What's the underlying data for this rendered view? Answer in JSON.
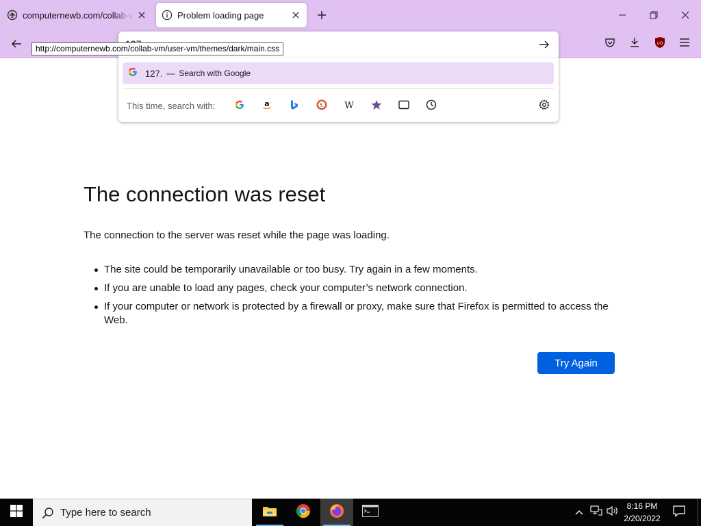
{
  "browser": {
    "tabs": [
      {
        "label": "computernewb.com/collab-vm",
        "icon": "vm-site-icon",
        "active": false
      },
      {
        "label": "Problem loading page",
        "icon": "info-icon",
        "active": true
      }
    ],
    "urlbar": {
      "value": "127.",
      "suggestion_query": "127.",
      "suggestion_separator": "—",
      "suggestion_action": "Search with Google",
      "oneoff_label": "This time, search with:",
      "engines": [
        "google-icon",
        "amazon-icon",
        "bing-icon",
        "duckduckgo-icon",
        "wikipedia-icon",
        "bookmarks-icon",
        "tabs-icon",
        "history-icon"
      ]
    },
    "status_link": "http://computernewb.com/collab-vm/user-vm/themes/dark/main.css",
    "accent_color": "#e0c1f1"
  },
  "error_page": {
    "title": "The connection was reset",
    "description": "The connection to the server was reset while the page was loading.",
    "bullets": [
      "The site could be temporarily unavailable or too busy. Try again in a few moments.",
      "If you are unable to load any pages, check your computer’s network connection.",
      "If your computer or network is protected by a firewall or proxy, make sure that Firefox is permitted to access the Web."
    ],
    "button_label": "Try Again",
    "button_color": "#0061e0"
  },
  "taskbar": {
    "search_placeholder": "Type here to search",
    "apps": [
      "file-explorer-icon",
      "chrome-icon",
      "firefox-icon",
      "terminal-icon"
    ],
    "time": "8:16 PM",
    "date": "2/20/2022"
  }
}
